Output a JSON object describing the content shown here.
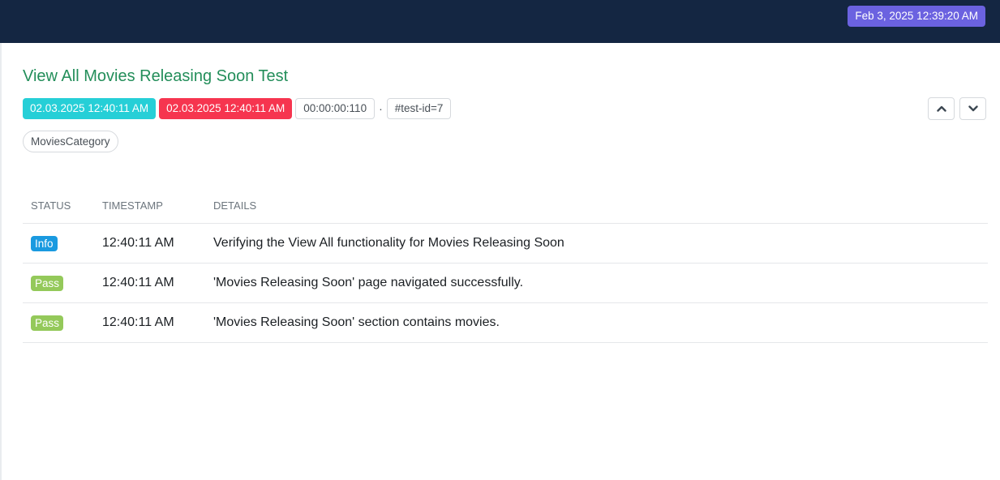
{
  "header": {
    "date": "Feb 3, 2025 12:39:20 AM",
    "background_color": "#142642",
    "date_badge_color": "#6b62e0"
  },
  "test": {
    "title": "View All Movies Releasing Soon Test",
    "title_color": "#238e5a",
    "start_time": "02.03.2025 12:40:11 AM",
    "end_time": "02.03.2025 12:40:11 AM",
    "duration": "00:00:00:110",
    "separator": "·",
    "test_id": "#test-id=7",
    "category": "MoviesCategory",
    "nav": {
      "up_icon": "chevron-up-icon",
      "down_icon": "chevron-down-icon"
    }
  },
  "log_table": {
    "headers": [
      "STATUS",
      "TIMESTAMP",
      "DETAILS"
    ],
    "rows": [
      {
        "status": "Info",
        "status_color": "#1a9ae0",
        "timestamp": "12:40:11 AM",
        "details": "Verifying the View All functionality for Movies Releasing Soon"
      },
      {
        "status": "Pass",
        "status_color": "#94c95a",
        "timestamp": "12:40:11 AM",
        "details": "'Movies Releasing Soon' page navigated successfully."
      },
      {
        "status": "Pass",
        "status_color": "#94c95a",
        "timestamp": "12:40:11 AM",
        "details": "'Movies Releasing Soon' section contains movies."
      }
    ]
  }
}
